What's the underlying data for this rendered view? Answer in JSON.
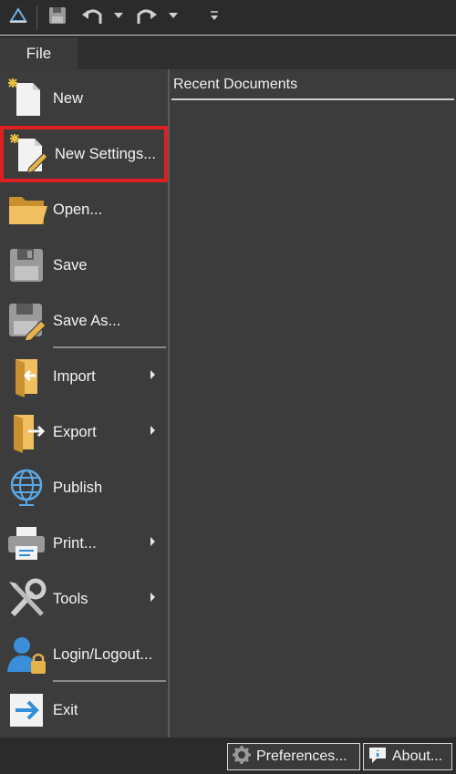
{
  "quick_access": {
    "items": [
      "app-icon",
      "save-icon",
      "undo-icon",
      "redo-icon",
      "customize-icon"
    ]
  },
  "file_tab": {
    "label": "File"
  },
  "menu": {
    "items": [
      {
        "label": "New",
        "icon": "new-document-icon"
      },
      {
        "label": "New Settings...",
        "icon": "new-settings-icon",
        "highlighted": true
      },
      {
        "label": "Open...",
        "icon": "open-folder-icon"
      },
      {
        "label": "Save",
        "icon": "save-icon"
      },
      {
        "label": "Save As...",
        "icon": "save-as-icon"
      },
      {
        "label": "Import",
        "icon": "import-icon",
        "submenu": true
      },
      {
        "label": "Export",
        "icon": "export-icon",
        "submenu": true
      },
      {
        "label": "Publish",
        "icon": "globe-icon"
      },
      {
        "label": "Print...",
        "icon": "printer-icon",
        "submenu": true
      },
      {
        "label": "Tools",
        "icon": "tools-icon",
        "submenu": true
      },
      {
        "label": "Login/Logout...",
        "icon": "user-lock-icon"
      },
      {
        "label": "Exit",
        "icon": "exit-icon"
      }
    ]
  },
  "recent": {
    "header": "Recent Documents"
  },
  "footer": {
    "preferences_label": "Preferences...",
    "about_label": "About..."
  },
  "colors": {
    "highlight_border": "#e02020",
    "accent_blue": "#2f8fd8",
    "folder": "#e6b24a"
  }
}
